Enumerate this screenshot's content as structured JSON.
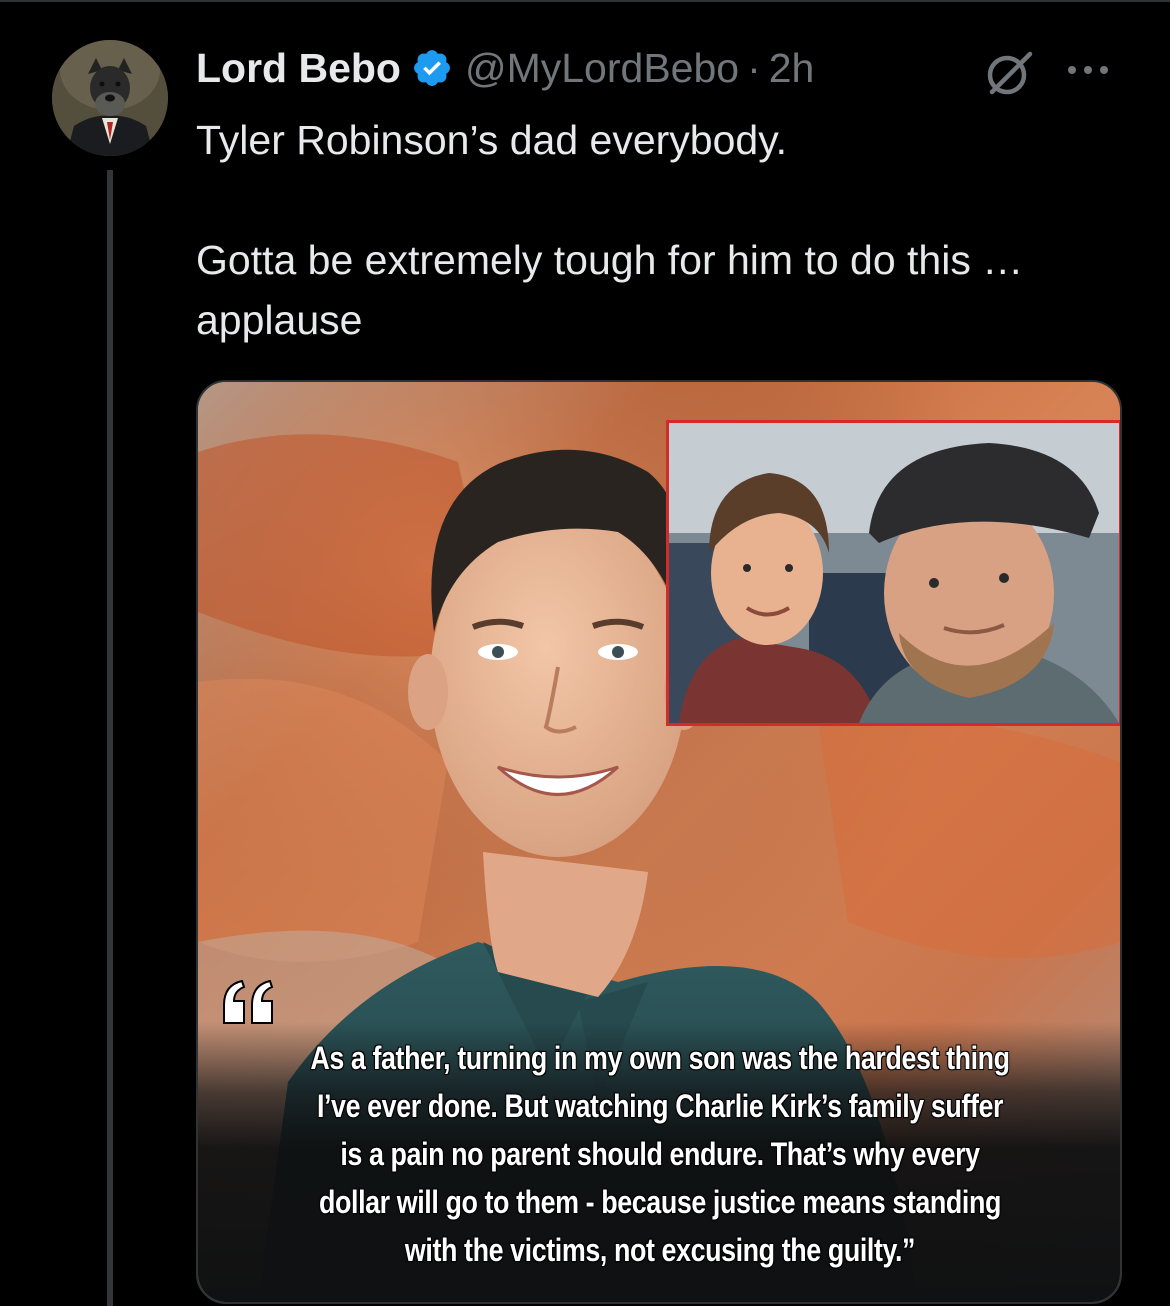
{
  "post": {
    "author": {
      "display_name": "Lord Bebo",
      "handle": "@MyLordBebo",
      "separator": "·",
      "time": "2h",
      "verified": true,
      "avatar_icon": "avatar-dog-in-suit"
    },
    "text_lines": [
      "Tyler Robinson’s dad everybody.",
      "Gotta be extremely tough for him to do this … applause"
    ],
    "actions": {
      "grok_icon": "grok-icon",
      "more_icon": "more-icon"
    },
    "media": {
      "quote_lines": [
        "As a father, turning in my own son was the hardest thing",
        "I’ve ever done. But watching Charlie Kirk’s family suffer",
        "is a pain no parent should endure. That’s why every",
        "dollar will go to them - because justice means standing",
        "with the victims, not excusing the guilty.”"
      ],
      "inset_border_color": "#d42a2a"
    }
  },
  "colors": {
    "background": "#000000",
    "text_primary": "#e7e9ea",
    "text_secondary": "#71767b",
    "verified_blue": "#1d9bf0",
    "divider": "#2f3336"
  }
}
